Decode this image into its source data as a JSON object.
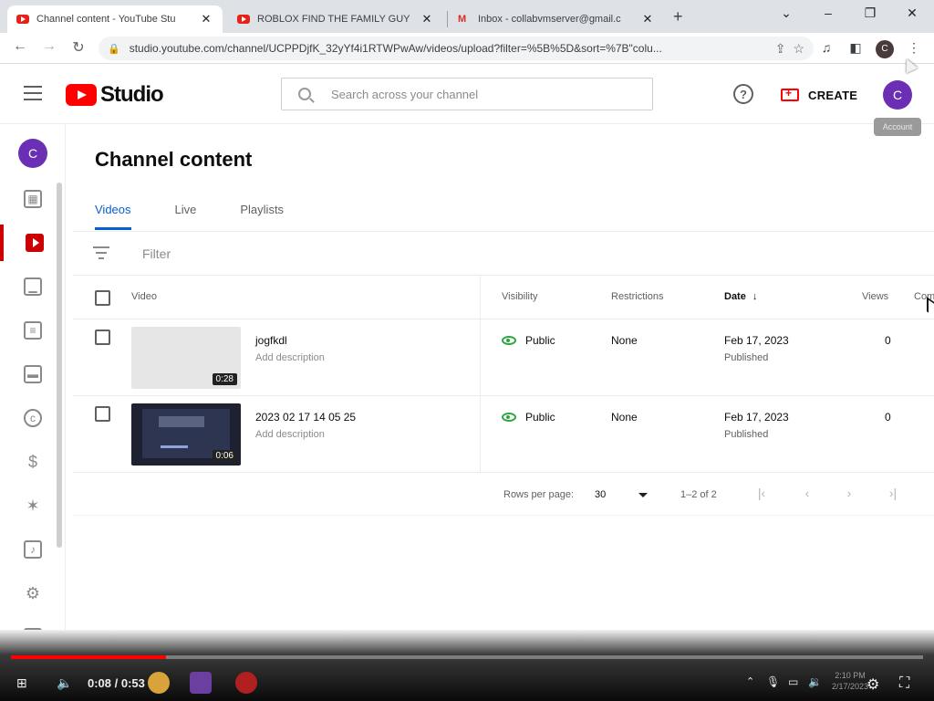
{
  "browser": {
    "tabs": [
      {
        "label": "Channel content - YouTube Stu",
        "active": true,
        "icon": "youtube-icon"
      },
      {
        "label": "ROBLOX FIND THE FAMILY GUY",
        "active": false,
        "icon": "youtube-icon"
      },
      {
        "label": "Inbox - collabvmserver@gmail.c",
        "active": false,
        "icon": "gmail-icon"
      }
    ],
    "url": "studio.youtube.com/channel/UCPPDjfK_32yYf4i1RTWPwAw/videos/upload?filter=%5B%5D&sort=%7B\"colu...",
    "profile_initial": "C"
  },
  "studio": {
    "logo_text": "Studio",
    "search_placeholder": "Search across your channel",
    "create_label": "CREATE",
    "avatar_initial": "C",
    "tooltip": "Account"
  },
  "page": {
    "title": "Channel content",
    "tabs": [
      "Videos",
      "Live",
      "Playlists"
    ],
    "filter_label": "Filter",
    "columns": {
      "video": "Video",
      "visibility": "Visibility",
      "restrictions": "Restrictions",
      "date": "Date",
      "date_sort": "↓",
      "views": "Views",
      "comments": "Com"
    },
    "rows": [
      {
        "title": "jogfkdl",
        "description": "Add description",
        "duration": "0:28",
        "visibility": "Public",
        "restrictions": "None",
        "date": "Feb 17, 2023",
        "date_status": "Published",
        "views": "0",
        "thumbnail": "blank"
      },
      {
        "title": "2023 02 17 14 05 25",
        "description": "Add description",
        "duration": "0:06",
        "visibility": "Public",
        "restrictions": "None",
        "date": "Feb 17, 2023",
        "date_status": "Published",
        "views": "0",
        "thumbnail": "screen-recording"
      }
    ],
    "pagination": {
      "rows_per_page_label": "Rows per page:",
      "rows_per_page": "30",
      "range": "1–2 of 2"
    }
  },
  "player": {
    "time": "0:08 / 0:53",
    "progress_fraction": 0.17,
    "clock_time": "2:10 PM",
    "clock_date": "2/17/2023"
  },
  "colors": {
    "accent_blue": "#065fd4",
    "youtube_red": "#ff0000",
    "avatar_purple": "#6a2fb5",
    "public_green": "#2ba640"
  }
}
